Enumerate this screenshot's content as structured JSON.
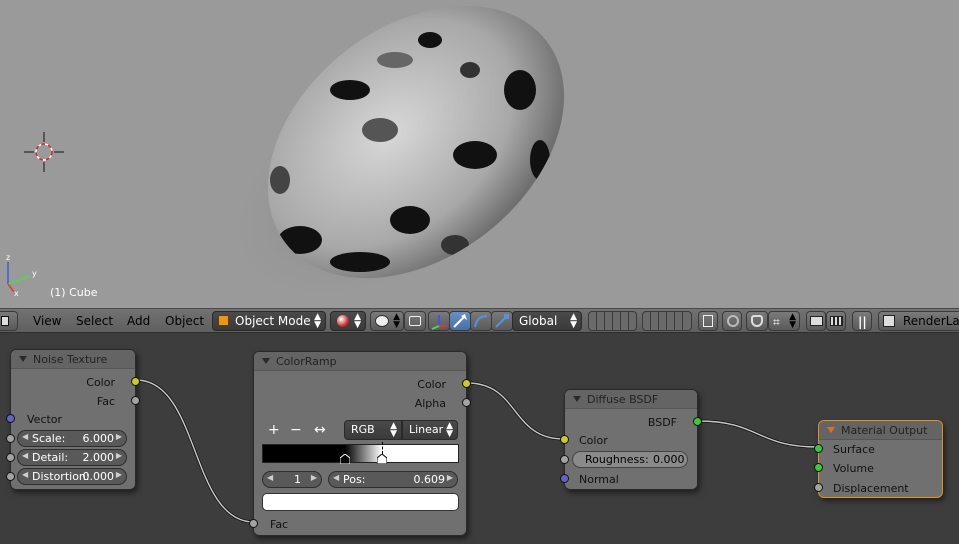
{
  "viewport": {
    "object_label": "(1) Cube",
    "axis_z": "z",
    "axis_y": "y",
    "axis_x": "x"
  },
  "header": {
    "menus": [
      "View",
      "Select",
      "Add",
      "Object"
    ],
    "mode": "Object Mode",
    "orientation": "Global",
    "render_layer": "RenderLaye"
  },
  "nodes": {
    "noise_texture": {
      "title": "Noise Texture",
      "out_color": "Color",
      "out_fac": "Fac",
      "in_vector": "Vector",
      "scale_label": "Scale:",
      "scale_value": "6.000",
      "detail_label": "Detail:",
      "detail_value": "2.000",
      "distortion_label": "Distortion:",
      "distortion_value": "0.000"
    },
    "color_ramp": {
      "title": "ColorRamp",
      "out_color": "Color",
      "out_alpha": "Alpha",
      "add": "+",
      "remove": "−",
      "flip": "↔",
      "color_mode": "RGB",
      "interpolation": "Linear",
      "stop_index": "1",
      "pos_label": "Pos:",
      "pos_value": "0.609",
      "in_fac": "Fac"
    },
    "diffuse": {
      "title": "Diffuse BSDF",
      "out_bsdf": "BSDF",
      "in_color": "Color",
      "roughness_label": "Roughness:",
      "roughness_value": "0.000",
      "in_normal": "Normal"
    },
    "material_output": {
      "title": "Material Output",
      "surface": "Surface",
      "volume": "Volume",
      "displacement": "Displacement"
    }
  },
  "colors": {
    "socket_color": "#c9c934",
    "socket_float": "#a3a3a3",
    "socket_vector": "#6363c7",
    "socket_shader": "#3ec73e",
    "active_node_border": "#e2901e"
  }
}
